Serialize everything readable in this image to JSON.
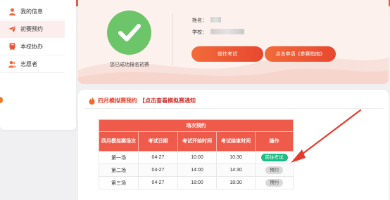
{
  "sidebar": {
    "items": [
      {
        "label": "我的信息",
        "icon": "user-icon"
      },
      {
        "label": "初赛预约",
        "icon": "paper-plane-icon"
      },
      {
        "label": "本校协办",
        "icon": "medal-icon"
      },
      {
        "label": "志愿者",
        "icon": "users-icon"
      }
    ]
  },
  "status": {
    "success_text": "您已成功报名初赛"
  },
  "profile": {
    "name_label": "姓名：",
    "school_label": "学校："
  },
  "actions": {
    "go_exam_label": "前往考试",
    "apply_guide_label": "点击申请《参赛指南》"
  },
  "mock_section": {
    "title": "四月模拟赛预约",
    "link_text": "【点击查看模拟赛通知"
  },
  "table": {
    "group_header": "场次预约",
    "headers": [
      "四月模拟赛场次",
      "考试日期",
      "考试开始时间",
      "考试结束时间",
      "操作"
    ],
    "rows": [
      {
        "session": "第一场",
        "date": "04-27",
        "start": "10:00",
        "end": "10:30",
        "action": "前往考试",
        "action_type": "go"
      },
      {
        "session": "第二场",
        "date": "04-27",
        "start": "14:00",
        "end": "14:30",
        "action": "预约",
        "action_type": "reserve"
      },
      {
        "session": "第三场",
        "date": "04-27",
        "start": "18:00",
        "end": "18:30",
        "action": "预约",
        "action_type": "reserve"
      }
    ]
  },
  "colors": {
    "accent": "#ed5a48",
    "success": "#6cc569",
    "go_button": "#1bbf86",
    "annotation_arrow": "#e53b2e"
  }
}
